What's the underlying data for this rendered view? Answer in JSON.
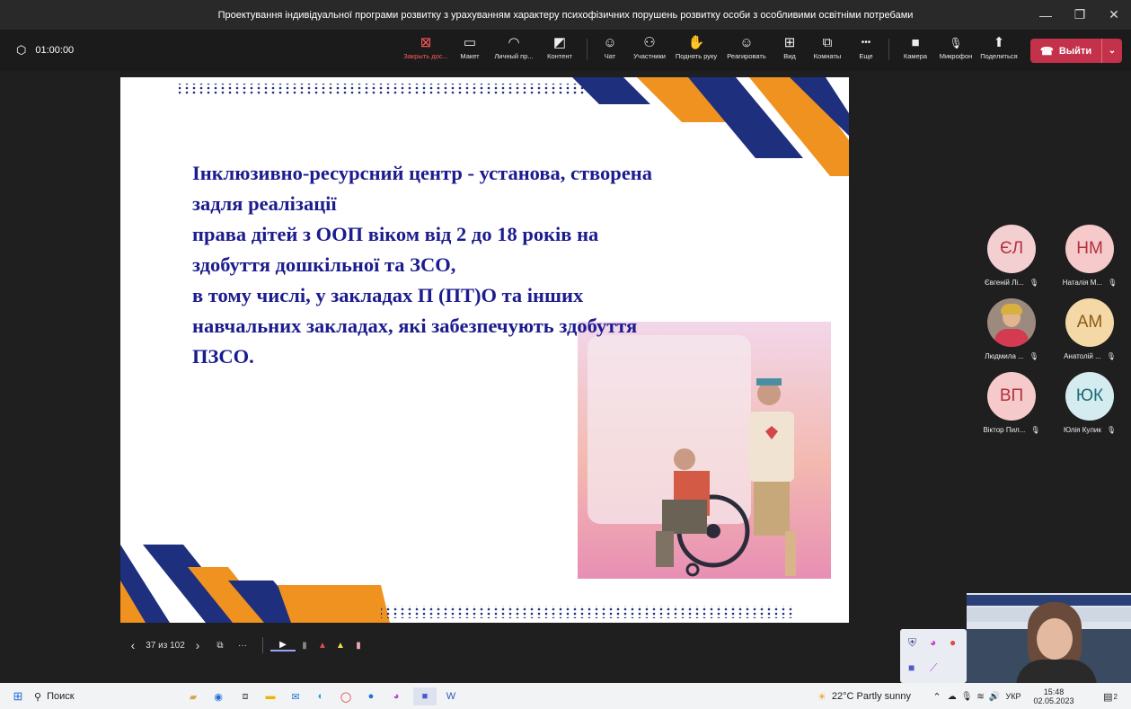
{
  "window": {
    "title": "Проектування індивідуальної програми розвитку з урахуванням характеру психофізичних порушень розвитку особи з особливими освітніми потребами",
    "controls": [
      "—",
      "❐",
      "✕"
    ]
  },
  "toolbar": {
    "timer": "01:00:00",
    "buttons": [
      {
        "label": "Закрыть дос...",
        "icon": "close-share-icon",
        "glyph": "⊠"
      },
      {
        "label": "Макет",
        "icon": "layout-icon",
        "glyph": "▭"
      },
      {
        "label": "Личный пр...",
        "icon": "personal-view-icon",
        "glyph": "◠"
      },
      {
        "label": "Контент",
        "icon": "content-icon",
        "glyph": "◩"
      },
      {
        "label": "Чат",
        "icon": "chat-icon",
        "glyph": "☺"
      },
      {
        "label": "Участники",
        "icon": "participants-icon",
        "glyph": "⚇"
      },
      {
        "label": "Поднять руку",
        "icon": "raise-hand-icon",
        "glyph": "✋"
      },
      {
        "label": "Реагировать",
        "icon": "react-icon",
        "glyph": "☺"
      },
      {
        "label": "Вид",
        "icon": "view-icon",
        "glyph": "⊞"
      },
      {
        "label": "Комнаты",
        "icon": "rooms-icon",
        "glyph": "⧉"
      },
      {
        "label": "Еще",
        "icon": "more-icon",
        "glyph": "•••"
      },
      {
        "label": "Камера",
        "icon": "camera-icon",
        "glyph": "■"
      },
      {
        "label": "Микрофон",
        "icon": "microphone-icon",
        "glyph": "🎙"
      },
      {
        "label": "Поделиться",
        "icon": "share-icon",
        "glyph": "⬆"
      }
    ],
    "leave_label": "Выйти"
  },
  "slide": {
    "lines": [
      "Інклюзивно-ресурсний центр - установа, створена",
      "задля реалізації",
      "права дітей з ООП віком від 2 до 18 років на",
      "здобуття дошкільної та ЗСО,",
      "в тому числі, у закладах П (ПТ)О та інших",
      "навчальних закладах, які забезпечують здобуття",
      "ПЗСО."
    ],
    "colors": {
      "text": "#1c1c8e",
      "navy": "#1e2f7d",
      "orange": "#f0921f"
    }
  },
  "participants": [
    {
      "initials": "ЄЛ",
      "name": "Євгеній Лі...",
      "color": "#f4cfd2",
      "fg": "#b0323a"
    },
    {
      "initials": "НМ",
      "name": "Наталія М...",
      "color": "#f6c9cb",
      "fg": "#b0323a"
    },
    {
      "initials": "",
      "name": "Людмила ...",
      "color": "#9c8a7e",
      "fg": "#fff",
      "photo": true
    },
    {
      "initials": "АМ",
      "name": "Анатолій ...",
      "color": "#f4d8a6",
      "fg": "#8a5a14"
    },
    {
      "initials": "ВП",
      "name": "Віктор Пил...",
      "color": "#f6c9cb",
      "fg": "#b0323a"
    },
    {
      "initials": "ЮК",
      "name": "Юлія Кулик",
      "color": "#d4ecef",
      "fg": "#1e6c7a"
    }
  ],
  "slide_nav": {
    "counter": "37 из 102"
  },
  "taskbar": {
    "search_label": "Поиск",
    "weather": "22°C  Partly sunny",
    "language": "УКР",
    "time": "15:48",
    "date": "02.05.2023",
    "notification_count": "2"
  }
}
